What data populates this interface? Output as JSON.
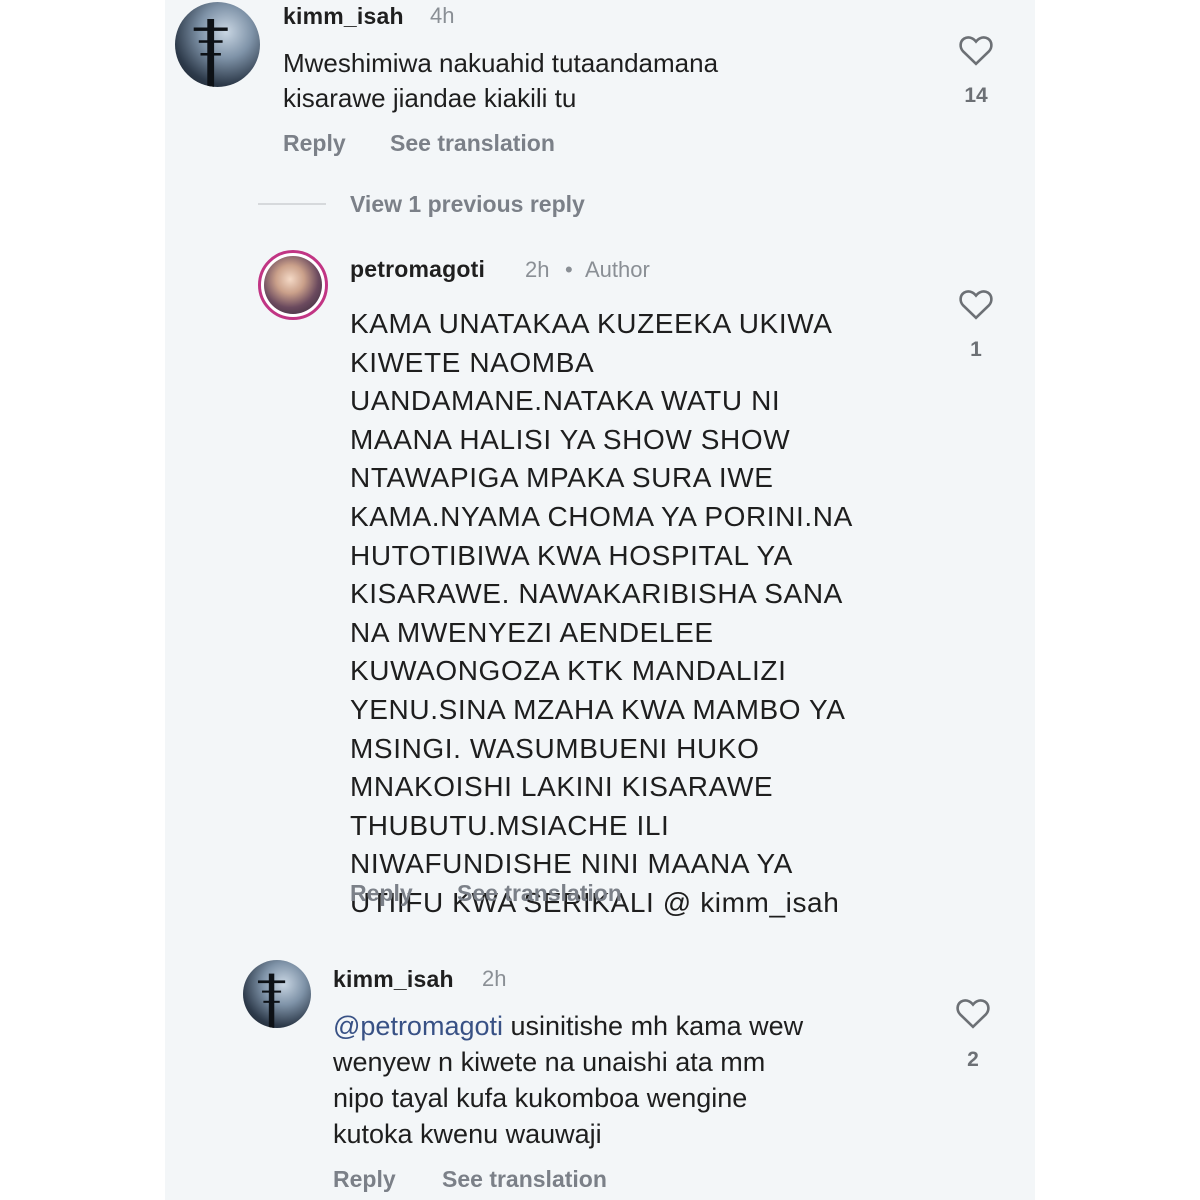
{
  "comments": [
    {
      "username": "kimm_isah",
      "time": "4h",
      "text_lines": [
        "Mweshimiwa nakuahid tutaandamana",
        "kisarawe jiandae kiakili tu"
      ],
      "likes": "14",
      "reply_label": "Reply",
      "translate_label": "See translation"
    }
  ],
  "view_previous": "View 1 previous reply",
  "replies": [
    {
      "username": "petromagoti",
      "time": "2h",
      "dot": "•",
      "badge": "Author",
      "text_lines": [
        "KAMA UNATAKAA KUZEEKA UKIWA",
        "KIWETE NAOMBA",
        "UANDAMANE.NATAKA WATU NI",
        "MAANA HALISI YA SHOW SHOW",
        "NTAWAPIGA MPAKA SURA IWE",
        "KAMA.NYAMA CHOMA YA PORINI.NA",
        "HUTOTIBIWA KWA HOSPITAL YA",
        "KISARAWE. NAWAKARIBISHA SANA",
        "NA MWENYEZI AENDELEE",
        "KUWAONGOZA KTK MANDALIZI",
        "YENU.SINA MZAHA KWA MAMBO YA",
        "MSINGI. WASUMBUENI HUKO",
        "MNAKOISHI LAKINI KISARAWE",
        "THUBUTU.MSIACHE ILI",
        "NIWAFUNDISHE NINI MAANA YA",
        "UTIIFU KWA SERIKALI @ kimm_isah"
      ],
      "likes": "1",
      "reply_label": "Reply",
      "translate_label": "See translation"
    },
    {
      "username": "kimm_isah",
      "time": "2h",
      "mention": "@petromagoti",
      "text_line1_rest": " usinitishe mh kama wew",
      "text_lines_rest": [
        "wenyew n kiwete na unaishi ata mm",
        "nipo tayal kufa kukomboa wengine",
        "kutoka kwenu wauwaji"
      ],
      "likes": "2",
      "reply_label": "Reply",
      "translate_label": "See translation"
    }
  ],
  "icons": {
    "like": "heart-icon",
    "avatar_kimm": "avatar-photo",
    "avatar_petro": "avatar-photo"
  },
  "colors": {
    "panel_bg": "#f3f6f8",
    "mention": "#385185",
    "muted": "#7b8088",
    "story_ring": "#c13584"
  }
}
